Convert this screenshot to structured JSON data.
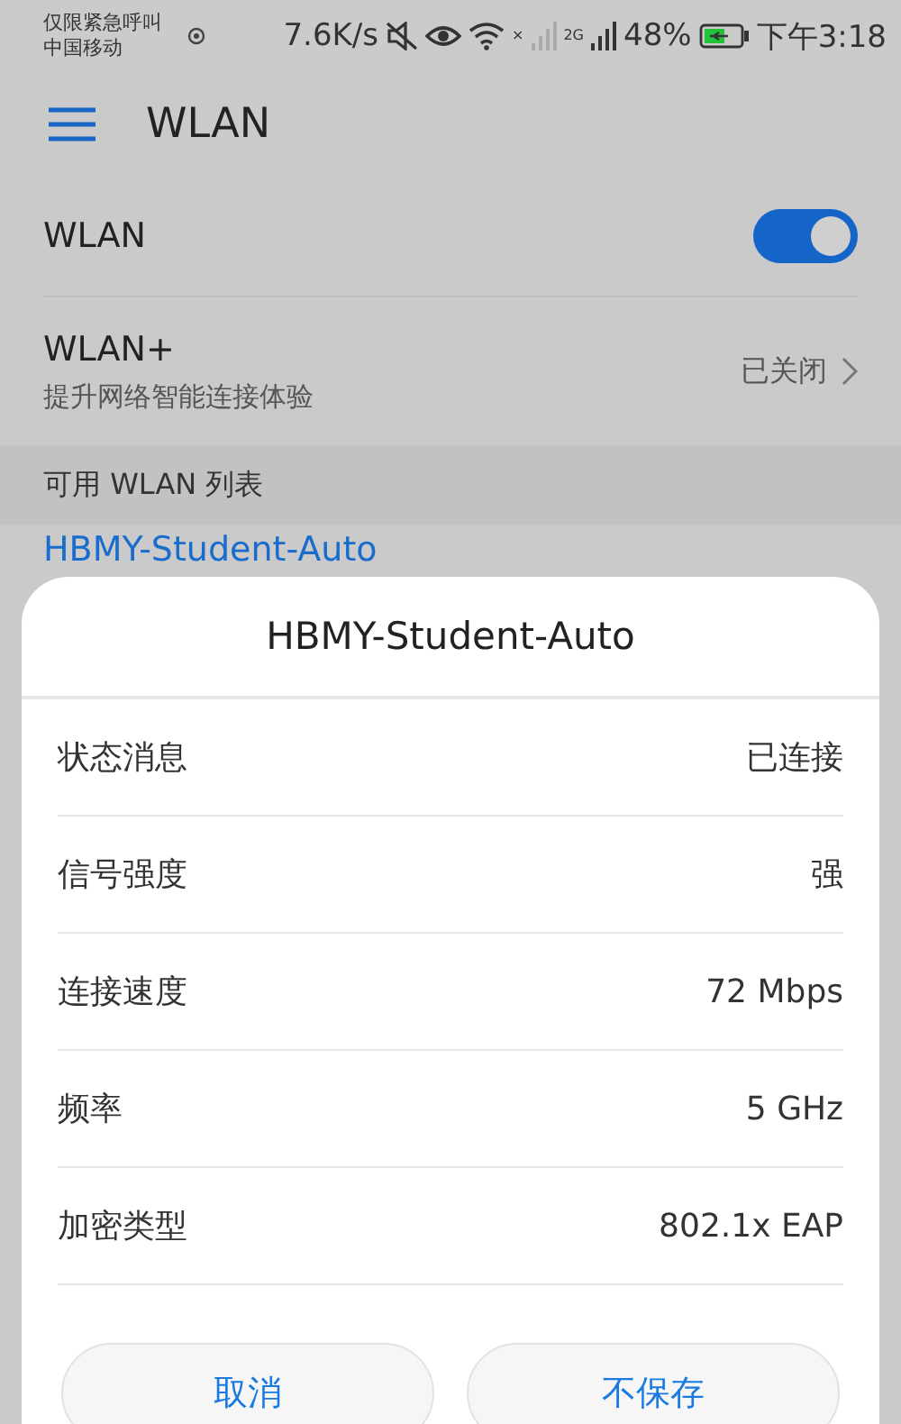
{
  "status_bar": {
    "carrier_lines": [
      "仅限紧急呼叫",
      "中国移动"
    ],
    "speed": "7.6K/s",
    "sim2_mark": "×",
    "network_type": "2G",
    "battery": "48%",
    "time": "下午3:18"
  },
  "app_bar": {
    "title": "WLAN"
  },
  "settings": [
    {
      "kind": "toggle",
      "label": "WLAN",
      "on": true
    },
    {
      "kind": "link",
      "label": "WLAN+",
      "subtitle": "提升网络智能连接体验",
      "value": "已关闭"
    }
  ],
  "section_header": "可用 WLAN 列表",
  "networks": [
    {
      "name": "HBMY-Student-Auto",
      "selected": true
    }
  ],
  "dialog": {
    "title": "HBMY-Student-Auto",
    "rows": [
      {
        "label": "状态消息",
        "value": "已连接"
      },
      {
        "label": "信号强度",
        "value": "强"
      },
      {
        "label": "连接速度",
        "value": "72 Mbps"
      },
      {
        "label": "频率",
        "value": "5 GHz"
      },
      {
        "label": "加密类型",
        "value": "802.1x EAP"
      }
    ],
    "buttons": [
      "取消",
      "不保存"
    ]
  }
}
